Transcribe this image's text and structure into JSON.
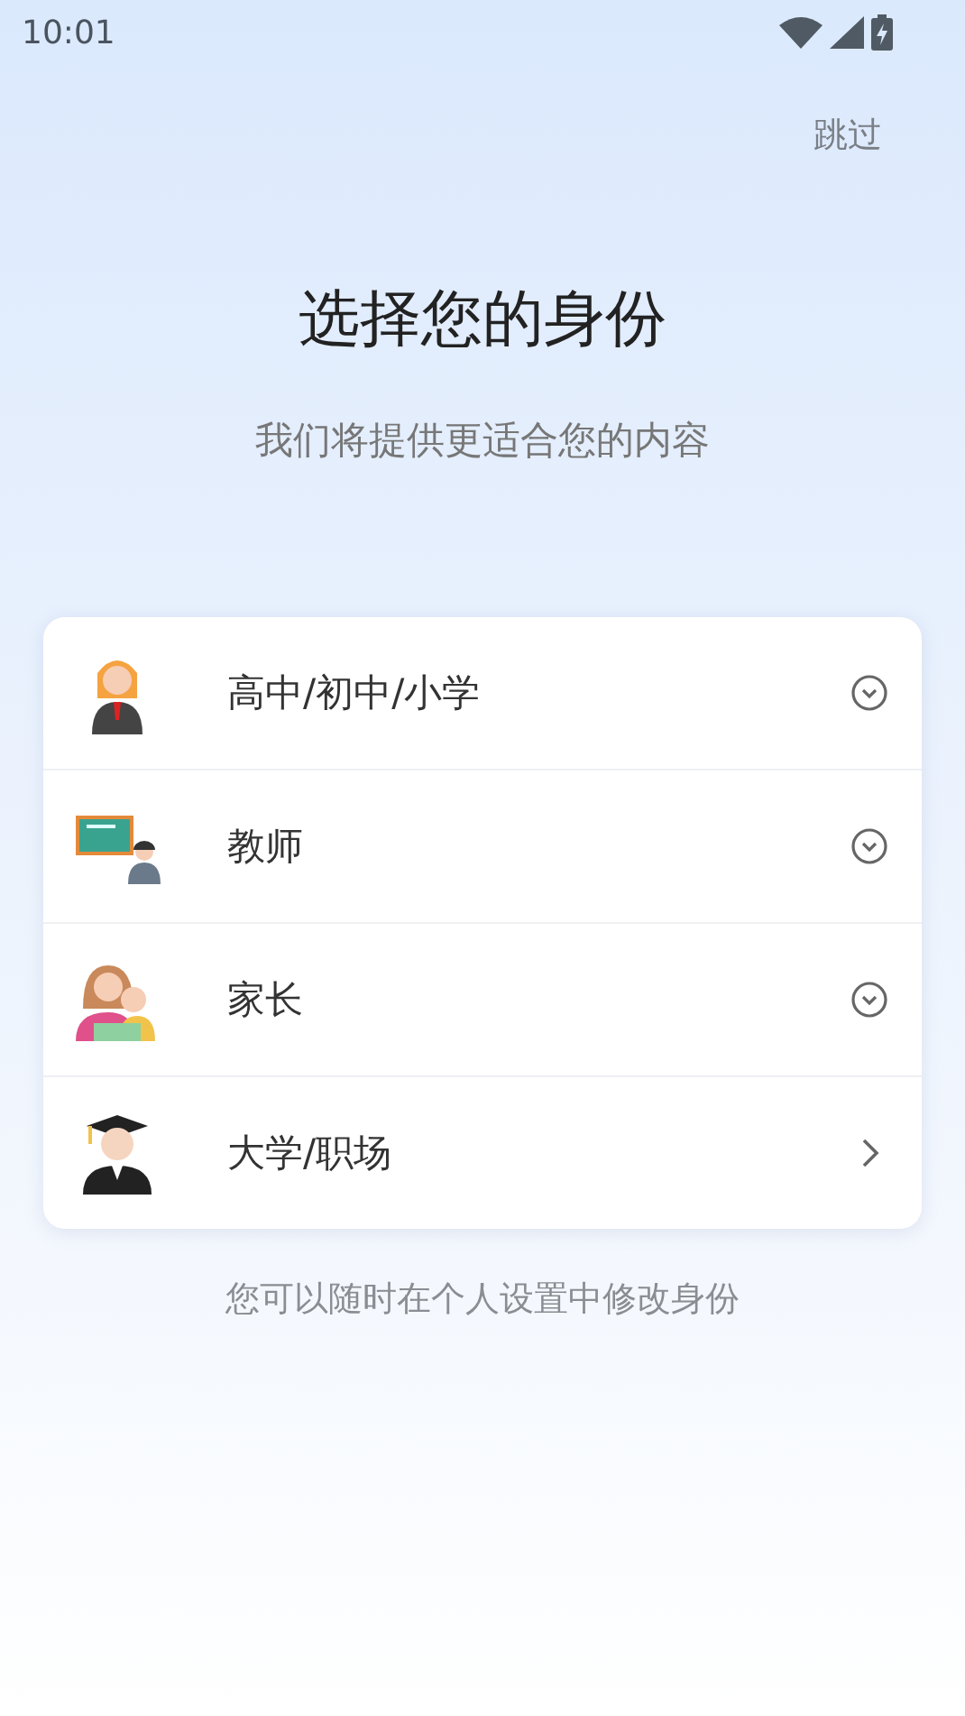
{
  "status_bar": {
    "time": "10:01"
  },
  "skip": "跳过",
  "title": "选择您的身份",
  "subtitle": "我们将提供更适合您的内容",
  "roles": [
    {
      "label": "高中/初中/小学",
      "kind": "student",
      "expandable": true
    },
    {
      "label": "教师",
      "kind": "teacher",
      "expandable": true
    },
    {
      "label": "家长",
      "kind": "parent",
      "expandable": true
    },
    {
      "label": "大学/职场",
      "kind": "graduate",
      "expandable": false
    }
  ],
  "footer": "您可以随时在个人设置中修改身份"
}
